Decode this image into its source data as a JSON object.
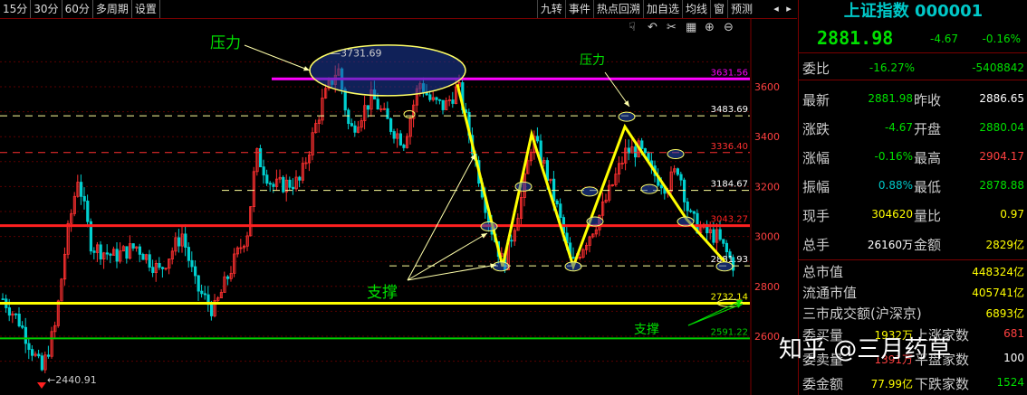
{
  "toolbar": {
    "left_items": [
      "15分",
      "30分",
      "60分",
      "多周期",
      "设置"
    ],
    "right_items": [
      "九转",
      "事件",
      "热点回溯",
      "加自选",
      "均线",
      "窗",
      "预测"
    ],
    "zoom_icons": [
      "hand-icon",
      "undo-icon",
      "scissors-icon",
      "grid-icon",
      "zoom-in-icon",
      "zoom-out-icon"
    ]
  },
  "chart": {
    "price_axis": [
      "3600",
      "3400",
      "3200",
      "3000",
      "2800",
      "2600"
    ],
    "levels": [
      {
        "label": "3631.56",
        "price": 3631.56,
        "color": "#ff00ff",
        "style": "solid",
        "width": 3
      },
      {
        "label": "3483.69",
        "price": 3483.69,
        "color": "#ffff99",
        "style": "dash",
        "width": 1
      },
      {
        "label": "3336.40",
        "price": 3336.4,
        "color": "#ff3030",
        "style": "dash",
        "width": 1
      },
      {
        "label": "3184.67",
        "price": 3184.67,
        "color": "#ffff99",
        "style": "dash",
        "width": 1
      },
      {
        "label": "3043.27",
        "price": 3043.27,
        "color": "#ff2020",
        "style": "solid",
        "width": 3
      },
      {
        "label": "2881.93",
        "price": 2881.93,
        "color": "#ffff99",
        "style": "dash",
        "width": 1
      },
      {
        "label": "2732.14",
        "price": 2732.14,
        "color": "#ffff00",
        "style": "solid",
        "width": 3
      },
      {
        "label": "2591.22",
        "price": 2591.22,
        "color": "#00cc00",
        "style": "solid",
        "width": 2
      }
    ],
    "high_label": "3731.69",
    "low_label": "2440.91",
    "annotations": {
      "pressure_left": "压力",
      "pressure_right": "压力",
      "support_left": "支撑",
      "support_right": "支撑"
    },
    "colors": {
      "up": "#ff3030",
      "down": "#00d0d0",
      "bg": "#000000"
    }
  },
  "panel": {
    "title": "上证指数 000001",
    "price": "2881.98",
    "change": "-4.67",
    "change_pct": "-0.16%",
    "wb_label": "委比",
    "wb_pct": "-16.27%",
    "wb_val": "-5408842",
    "rows": [
      {
        "l1": "最新",
        "v1": "2881.98",
        "c1": "grn",
        "l2": "昨收",
        "v2": "2886.65",
        "c2": "wht"
      },
      {
        "l1": "涨跌",
        "v1": "-4.67",
        "c1": "grn",
        "l2": "开盘",
        "v2": "2880.04",
        "c2": "grn"
      },
      {
        "l1": "涨幅",
        "v1": "-0.16%",
        "c1": "grn",
        "l2": "最高",
        "v2": "2904.17",
        "c2": "red"
      },
      {
        "l1": "振幅",
        "v1": "0.88%",
        "c1": "cyn",
        "l2": "最低",
        "v2": "2878.88",
        "c2": "grn"
      },
      {
        "l1": "现手",
        "v1": "304620",
        "c1": "ylw",
        "l2": "量比",
        "v2": "0.97",
        "c2": "ylw"
      },
      {
        "l1": "总手",
        "v1": "26160万",
        "c1": "wht",
        "l2": "金额",
        "v2": "2829亿",
        "c2": "ylw"
      }
    ],
    "market": [
      {
        "l": "总市值",
        "v": "448324亿",
        "c": "ylw"
      },
      {
        "l": "流通市值",
        "v": "405741亿",
        "c": "ylw"
      },
      {
        "l": "三市成交额(沪深京)",
        "v": "6893亿",
        "c": "ylw"
      }
    ],
    "bottom": [
      {
        "l1": "委买量",
        "v1": "1932万",
        "c1": "ylw",
        "l2": "上涨家数",
        "v2": "681",
        "c2": "red"
      },
      {
        "l1": "委卖量",
        "v1": "1391万",
        "c1": "red",
        "l2": "平盘家数",
        "v2": "100",
        "c2": "wht"
      },
      {
        "l1": "委金额",
        "v1": "77.99亿",
        "c1": "ylw",
        "l2": "下跌家数",
        "v2": "1524",
        "c2": "grn"
      }
    ]
  },
  "watermark": "知乎 @三月药草"
}
